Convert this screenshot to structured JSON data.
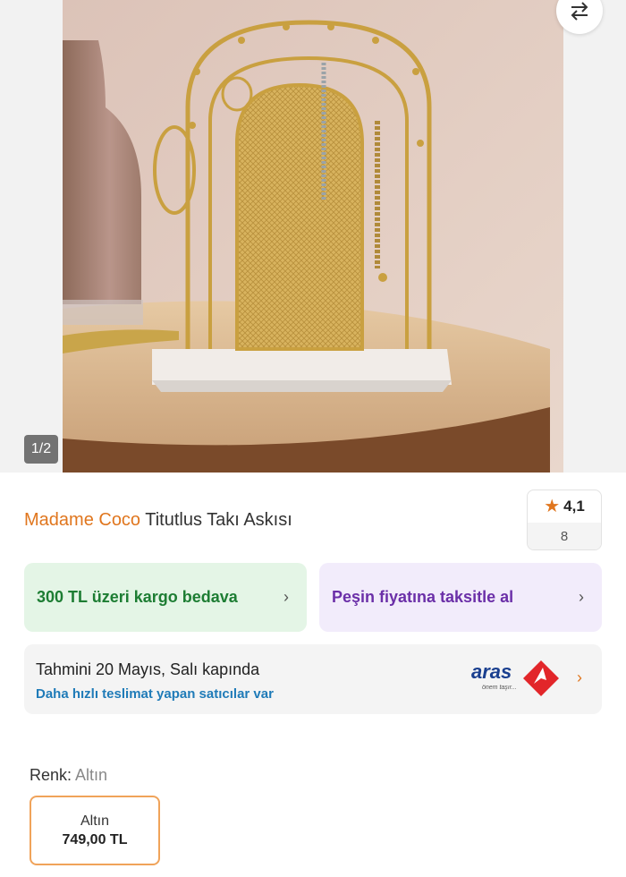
{
  "gallery": {
    "counter": "1/2",
    "photo_alt": "Jewelry stand product photo"
  },
  "product": {
    "brand": "Madame Coco",
    "name": "Titutlus Takı Askısı",
    "rating": "4,1",
    "review_count": "8"
  },
  "promos": [
    {
      "label": "300 TL üzeri kargo bedava",
      "color": "#1d7d33",
      "bg": "#e4f5e6"
    },
    {
      "label": "Peşin fiyatına taksitle al",
      "color": "#6b2fa8",
      "bg": "#f2ecfb"
    }
  ],
  "delivery": {
    "title": "Tahmini 20 Mayıs, Salı kapında",
    "subtitle": "Daha hızlı teslimat yapan satıcılar var",
    "carrier_logo": "aras",
    "carrier_tagline": "önem taşır..."
  },
  "color_select": {
    "label": "Renk:",
    "value": "Altın",
    "variants": [
      {
        "name": "Altın",
        "price": "749,00 TL"
      }
    ]
  },
  "colors": {
    "accent": "#e0761e",
    "link": "#1f7bb8",
    "star": "#e0761e"
  }
}
